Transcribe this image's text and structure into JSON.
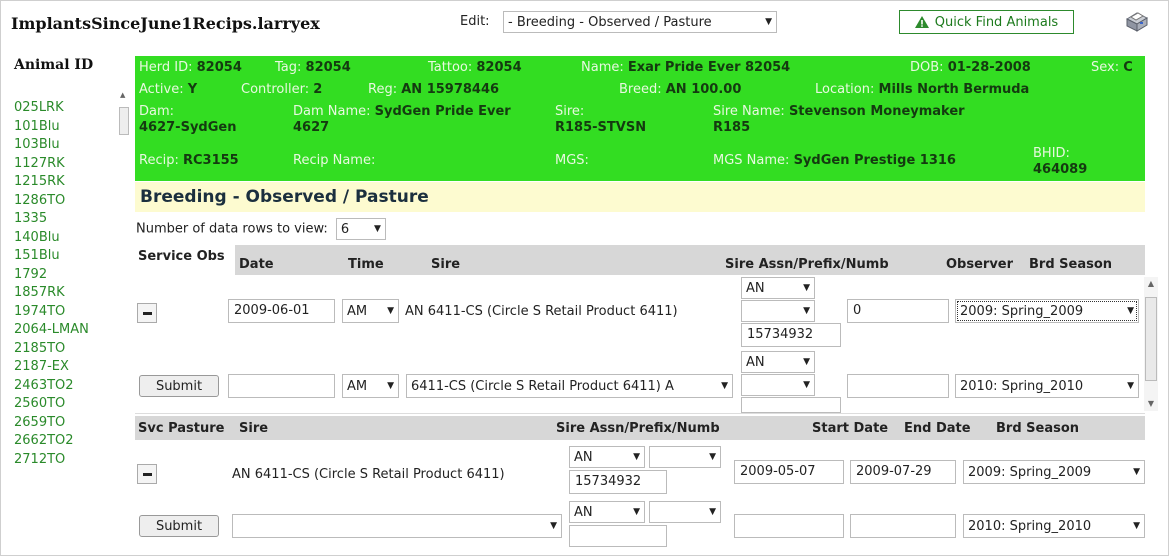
{
  "header": {
    "file_name": "ImplantsSinceJune1Recips.larryex",
    "edit_label": "Edit:",
    "edit_value": "- Breeding - Observed / Pasture",
    "quick_find_label": "Quick Find Animals"
  },
  "sidebar": {
    "title": "Animal ID",
    "animals": [
      "025LRK",
      "101Blu",
      "103Blu",
      "1127RK",
      "1215RK",
      "1286TO",
      "1335",
      "140Blu",
      "151Blu",
      "1792",
      "1857RK",
      "1974TO",
      "2064-LMAN",
      "2185TO",
      "2187-EX",
      "2463TO2",
      "2560TO",
      "2659TO",
      "2662TO2",
      "2712TO"
    ]
  },
  "animal_info": {
    "herd_id": {
      "label": "Herd ID:",
      "value": "82054"
    },
    "tag": {
      "label": "Tag:",
      "value": "82054"
    },
    "tattoo": {
      "label": "Tattoo:",
      "value": "82054"
    },
    "name": {
      "label": "Name:",
      "value": "Exar Pride Ever 82054"
    },
    "dob": {
      "label": "DOB:",
      "value": "01-28-2008"
    },
    "sex": {
      "label": "Sex:",
      "value": "C"
    },
    "active": {
      "label": "Active:",
      "value": "Y"
    },
    "controller": {
      "label": "Controller:",
      "value": "2"
    },
    "reg": {
      "label": "Reg:",
      "value": "AN 15978446"
    },
    "breed": {
      "label": "Breed:",
      "value": "AN 100.00"
    },
    "location": {
      "label": "Location:",
      "value": "Mills North Bermuda"
    },
    "dam": {
      "label": "Dam:",
      "value": "4627-SydGen"
    },
    "dam_name": {
      "label": "Dam Name:",
      "value": "SydGen Pride Ever",
      "value2": "4627"
    },
    "sire": {
      "label": "Sire:",
      "value": "R185-STVSN"
    },
    "sire_name": {
      "label": "Sire Name:",
      "value": "Stevenson Moneymaker",
      "value2": "R185"
    },
    "recip": {
      "label": "Recip:",
      "value": "RC3155"
    },
    "recip_name": {
      "label": "Recip Name:",
      "value": ""
    },
    "mgs": {
      "label": "MGS:",
      "value": ""
    },
    "mgs_name": {
      "label": "MGS Name:",
      "value": "SydGen Prestige 1316"
    },
    "bhid": {
      "label": "BHID:",
      "value": "464089"
    }
  },
  "section": {
    "title": "Breeding - Observed / Pasture",
    "rows_label": "Number of data rows to view:",
    "rows_value": "6"
  },
  "observed": {
    "headers": {
      "service": "Service Obs",
      "date": "Date",
      "time": "Time",
      "sire": "Sire",
      "assn": "Sire Assn/Prefix/Numb",
      "observer": "Observer",
      "season": "Brd Season"
    },
    "row1": {
      "date": "2009-06-01",
      "time": "AM",
      "sire": "AN 6411-CS (Circle S Retail Product 6411)",
      "assn": "AN",
      "prefix": "",
      "number": "15734932",
      "observer": "0",
      "season": "2009: Spring_2009"
    },
    "row2": {
      "submit": "Submit",
      "date": "",
      "time": "AM",
      "sire": "6411-CS (Circle S Retail Product 6411) A",
      "assn": "AN",
      "prefix": "",
      "number": "",
      "observer": "",
      "season": "2010: Spring_2010"
    }
  },
  "pasture": {
    "headers": {
      "service": "Svc Pasture",
      "sire": "Sire",
      "assn": "Sire Assn/Prefix/Numb",
      "start": "Start Date",
      "end": "End Date",
      "season": "Brd Season"
    },
    "row1": {
      "sire": "AN 6411-CS (Circle S Retail Product 6411)",
      "assn": "AN",
      "prefix": "",
      "number": "15734932",
      "start": "2009-05-07",
      "end": "2009-07-29",
      "season": "2009: Spring_2009"
    },
    "row2": {
      "submit": "Submit",
      "sire": "",
      "assn": "AN",
      "prefix": "",
      "number": "",
      "start": "",
      "end": "",
      "season": "2010: Spring_2010"
    }
  }
}
